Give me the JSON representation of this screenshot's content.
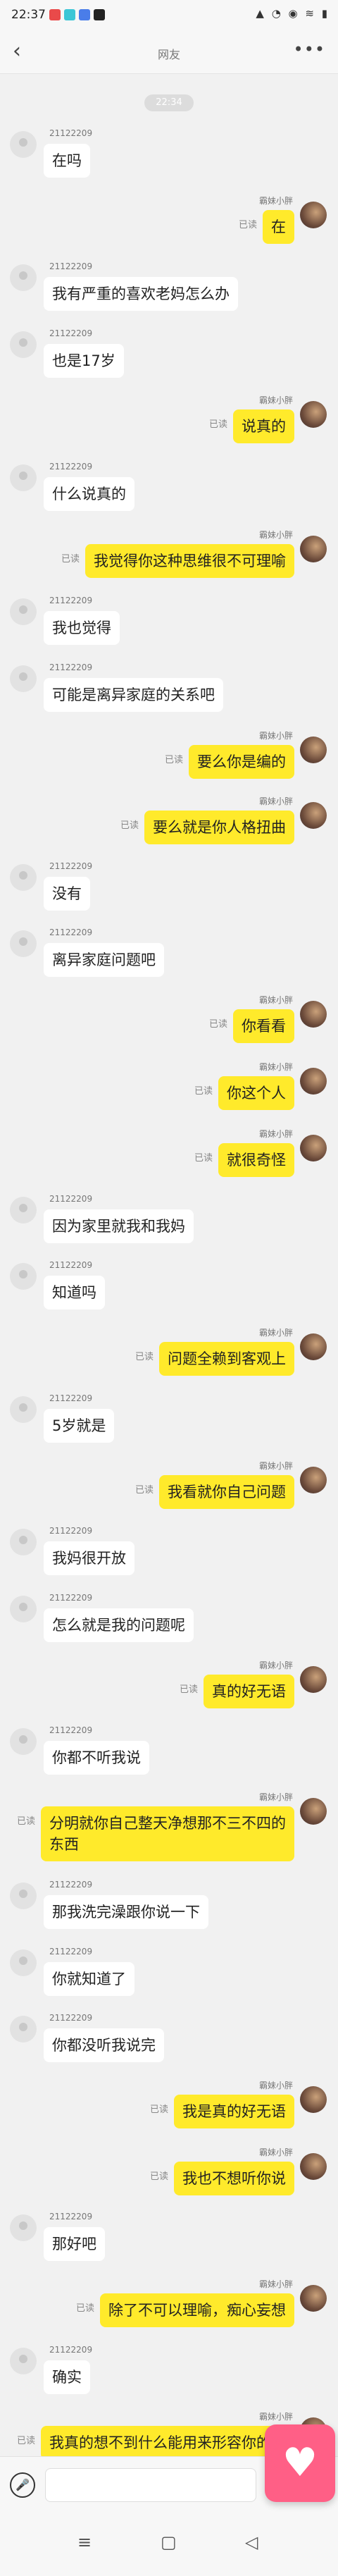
{
  "status_bar": {
    "time": "22:37",
    "system_icons": "▲ ◔ ◉ ≋ ▮"
  },
  "nav": {
    "title": "网友",
    "back": "‹",
    "more": "•••"
  },
  "timestamp": "22:34",
  "left_name": "21122209",
  "right_name": "霸妹小胖",
  "read_label": "已读",
  "messages": [
    {
      "side": "left",
      "text": "在吗"
    },
    {
      "side": "right",
      "text": "在"
    },
    {
      "side": "left",
      "text": "我有严重的喜欢老妈怎么办"
    },
    {
      "side": "left",
      "text": "也是17岁"
    },
    {
      "side": "right",
      "text": "说真的"
    },
    {
      "side": "left",
      "text": "什么说真的"
    },
    {
      "side": "right",
      "text": "我觉得你这种思维很不可理喻"
    },
    {
      "side": "left",
      "text": "我也觉得"
    },
    {
      "side": "left",
      "text": "可能是离异家庭的关系吧"
    },
    {
      "side": "right",
      "text": "要么你是编的"
    },
    {
      "side": "right",
      "text": "要么就是你人格扭曲"
    },
    {
      "side": "left",
      "text": "没有"
    },
    {
      "side": "left",
      "text": "离异家庭问题吧"
    },
    {
      "side": "right",
      "text": "你看看"
    },
    {
      "side": "right",
      "text": "你这个人"
    },
    {
      "side": "right",
      "text": "就很奇怪"
    },
    {
      "side": "left",
      "text": "因为家里就我和我妈"
    },
    {
      "side": "left",
      "text": "知道吗"
    },
    {
      "side": "right",
      "text": "问题全赖到客观上"
    },
    {
      "side": "left",
      "text": "5岁就是"
    },
    {
      "side": "right",
      "text": "我看就你自己问题"
    },
    {
      "side": "left",
      "text": "我妈很开放"
    },
    {
      "side": "left",
      "text": "怎么就是我的问题呢"
    },
    {
      "side": "right",
      "text": "真的好无语"
    },
    {
      "side": "left",
      "text": "你都不听我说"
    },
    {
      "side": "right",
      "text": "分明就你自己整天净想那不三不四的东西"
    },
    {
      "side": "left",
      "text": "那我洗完澡跟你说一下"
    },
    {
      "side": "left",
      "text": "你就知道了"
    },
    {
      "side": "left",
      "text": "你都没听我说完"
    },
    {
      "side": "right",
      "text": "我是真的好无语"
    },
    {
      "side": "right",
      "text": "我也不想听你说"
    },
    {
      "side": "left",
      "text": "那好吧"
    },
    {
      "side": "right",
      "text": "除了不可以理喻，痴心妄想"
    },
    {
      "side": "left",
      "text": "确实"
    },
    {
      "side": "right",
      "text": "我真的想不到什么能用来形容你的了"
    }
  ],
  "input_bar": {
    "mic_icon": "mic-icon",
    "plus_icon": "plus-icon"
  },
  "float_button": "heart-icon",
  "colors": {
    "right_bubble": "#ffea2b",
    "left_bubble": "#ffffff",
    "background": "#f1f1f1",
    "float_button": "#ff5f86"
  }
}
